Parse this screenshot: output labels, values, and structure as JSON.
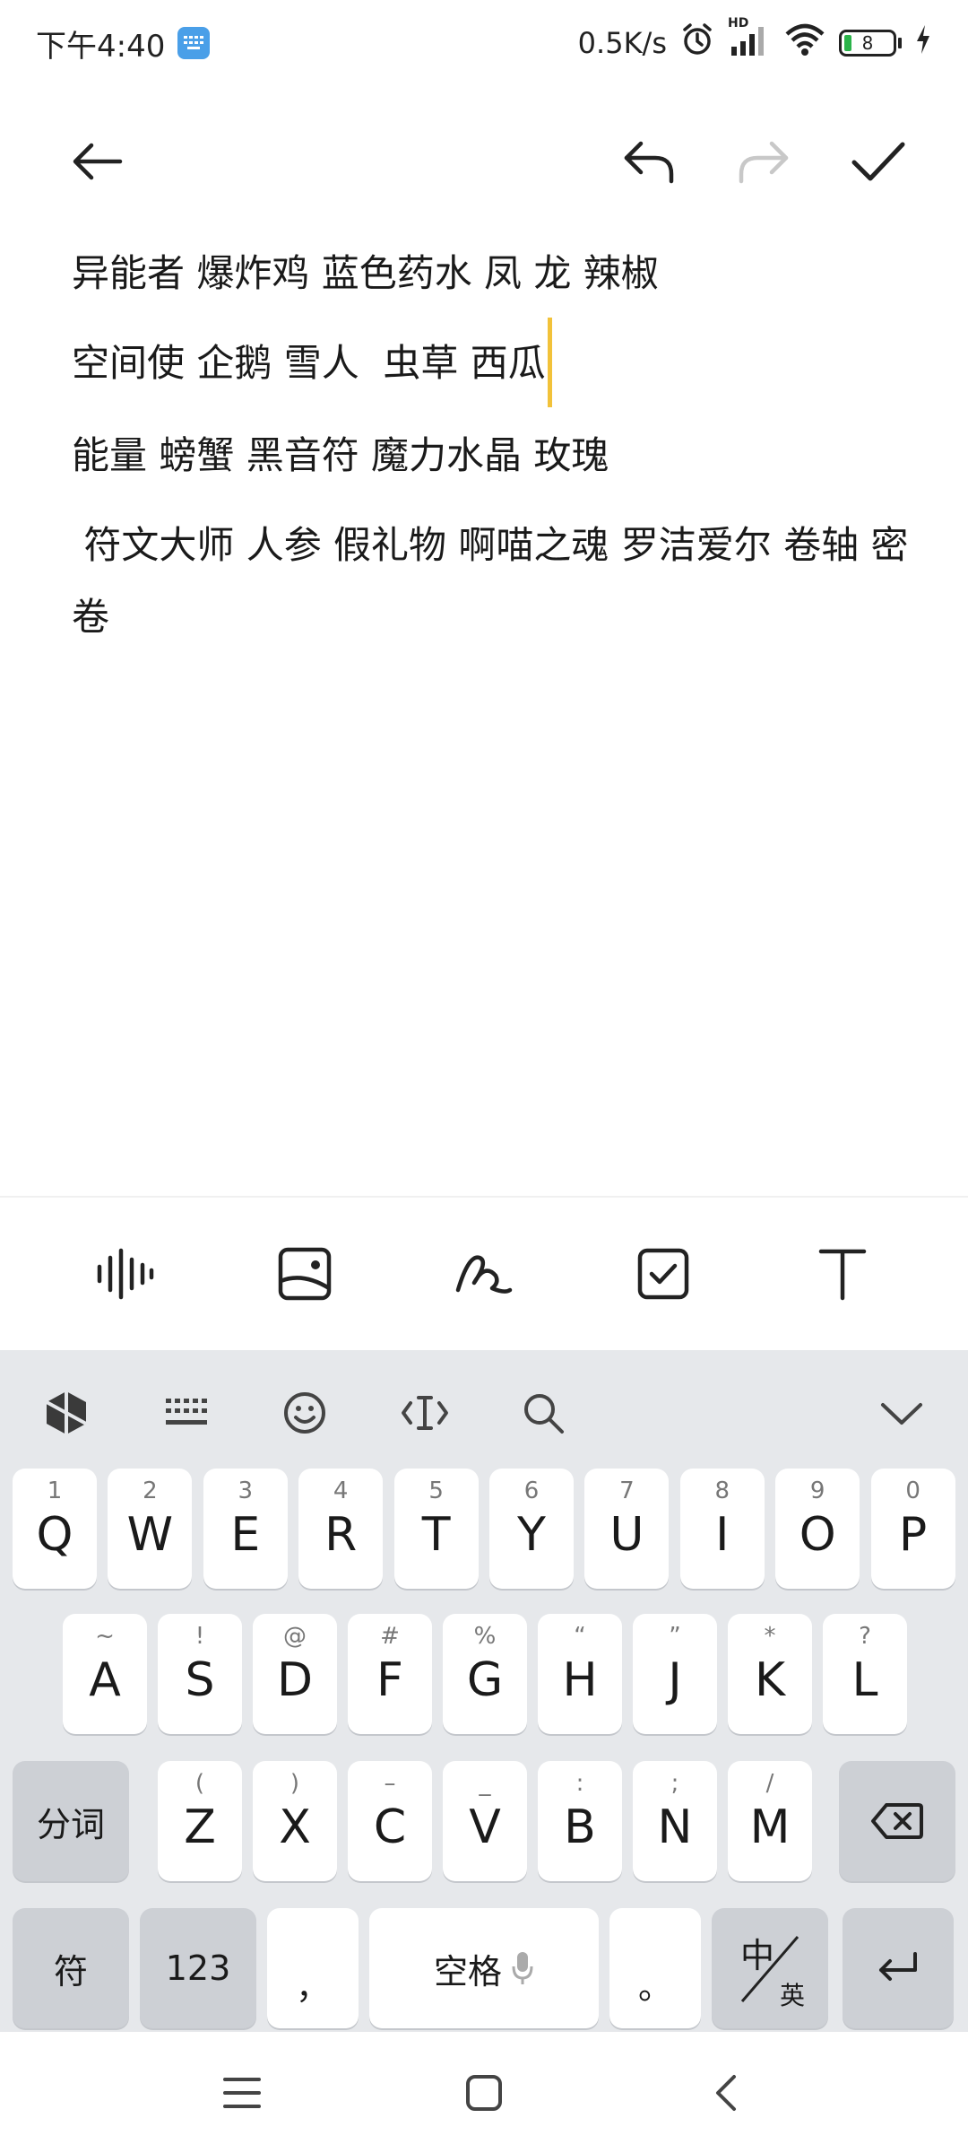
{
  "status": {
    "time": "下午4:40",
    "net_speed": "0.5K/s",
    "hd": "HD",
    "battery": "8"
  },
  "note": {
    "lines": [
      "异能者 爆炸鸡 蓝色药水 凤 龙 辣椒",
      "空间使 企鹅 雪人  虫草 西瓜",
      "能量 螃蟹 黑音符 魔力水晶 玫瑰",
      " 符文大师 人参 假礼物 啊喵之魂 罗洁爱尔 卷轴 密卷"
    ],
    "cursor_color": "#f2c23a"
  },
  "keyboard": {
    "row1": [
      {
        "hint": "1",
        "key": "Q"
      },
      {
        "hint": "2",
        "key": "W"
      },
      {
        "hint": "3",
        "key": "E"
      },
      {
        "hint": "4",
        "key": "R"
      },
      {
        "hint": "5",
        "key": "T"
      },
      {
        "hint": "6",
        "key": "Y"
      },
      {
        "hint": "7",
        "key": "U"
      },
      {
        "hint": "8",
        "key": "I"
      },
      {
        "hint": "9",
        "key": "O"
      },
      {
        "hint": "0",
        "key": "P"
      }
    ],
    "row2": [
      {
        "hint": "~",
        "key": "A"
      },
      {
        "hint": "!",
        "key": "S"
      },
      {
        "hint": "@",
        "key": "D"
      },
      {
        "hint": "#",
        "key": "F"
      },
      {
        "hint": "%",
        "key": "G"
      },
      {
        "hint": "“",
        "key": "H"
      },
      {
        "hint": "”",
        "key": "J"
      },
      {
        "hint": "*",
        "key": "K"
      },
      {
        "hint": "?",
        "key": "L"
      }
    ],
    "row3": [
      {
        "hint": "(",
        "key": "Z"
      },
      {
        "hint": ")",
        "key": "X"
      },
      {
        "hint": "–",
        "key": "C"
      },
      {
        "hint": "_",
        "key": "V"
      },
      {
        "hint": ":",
        "key": "B"
      },
      {
        "hint": ";",
        "key": "N"
      },
      {
        "hint": "/",
        "key": "M"
      }
    ],
    "segment_label": "分词",
    "symbols_label": "符",
    "numbers_label": "123",
    "comma_label": "，",
    "space_label": "空格",
    "period_label": "。",
    "lang_zh": "中",
    "lang_en": "英"
  },
  "colors": {
    "keyboard_bg": "#e6e8eb",
    "key_bg": "#ffffff",
    "func_key_bg": "#cdd0d5",
    "accent_cursor": "#f2c23a",
    "battery_green": "#2bb34a"
  }
}
